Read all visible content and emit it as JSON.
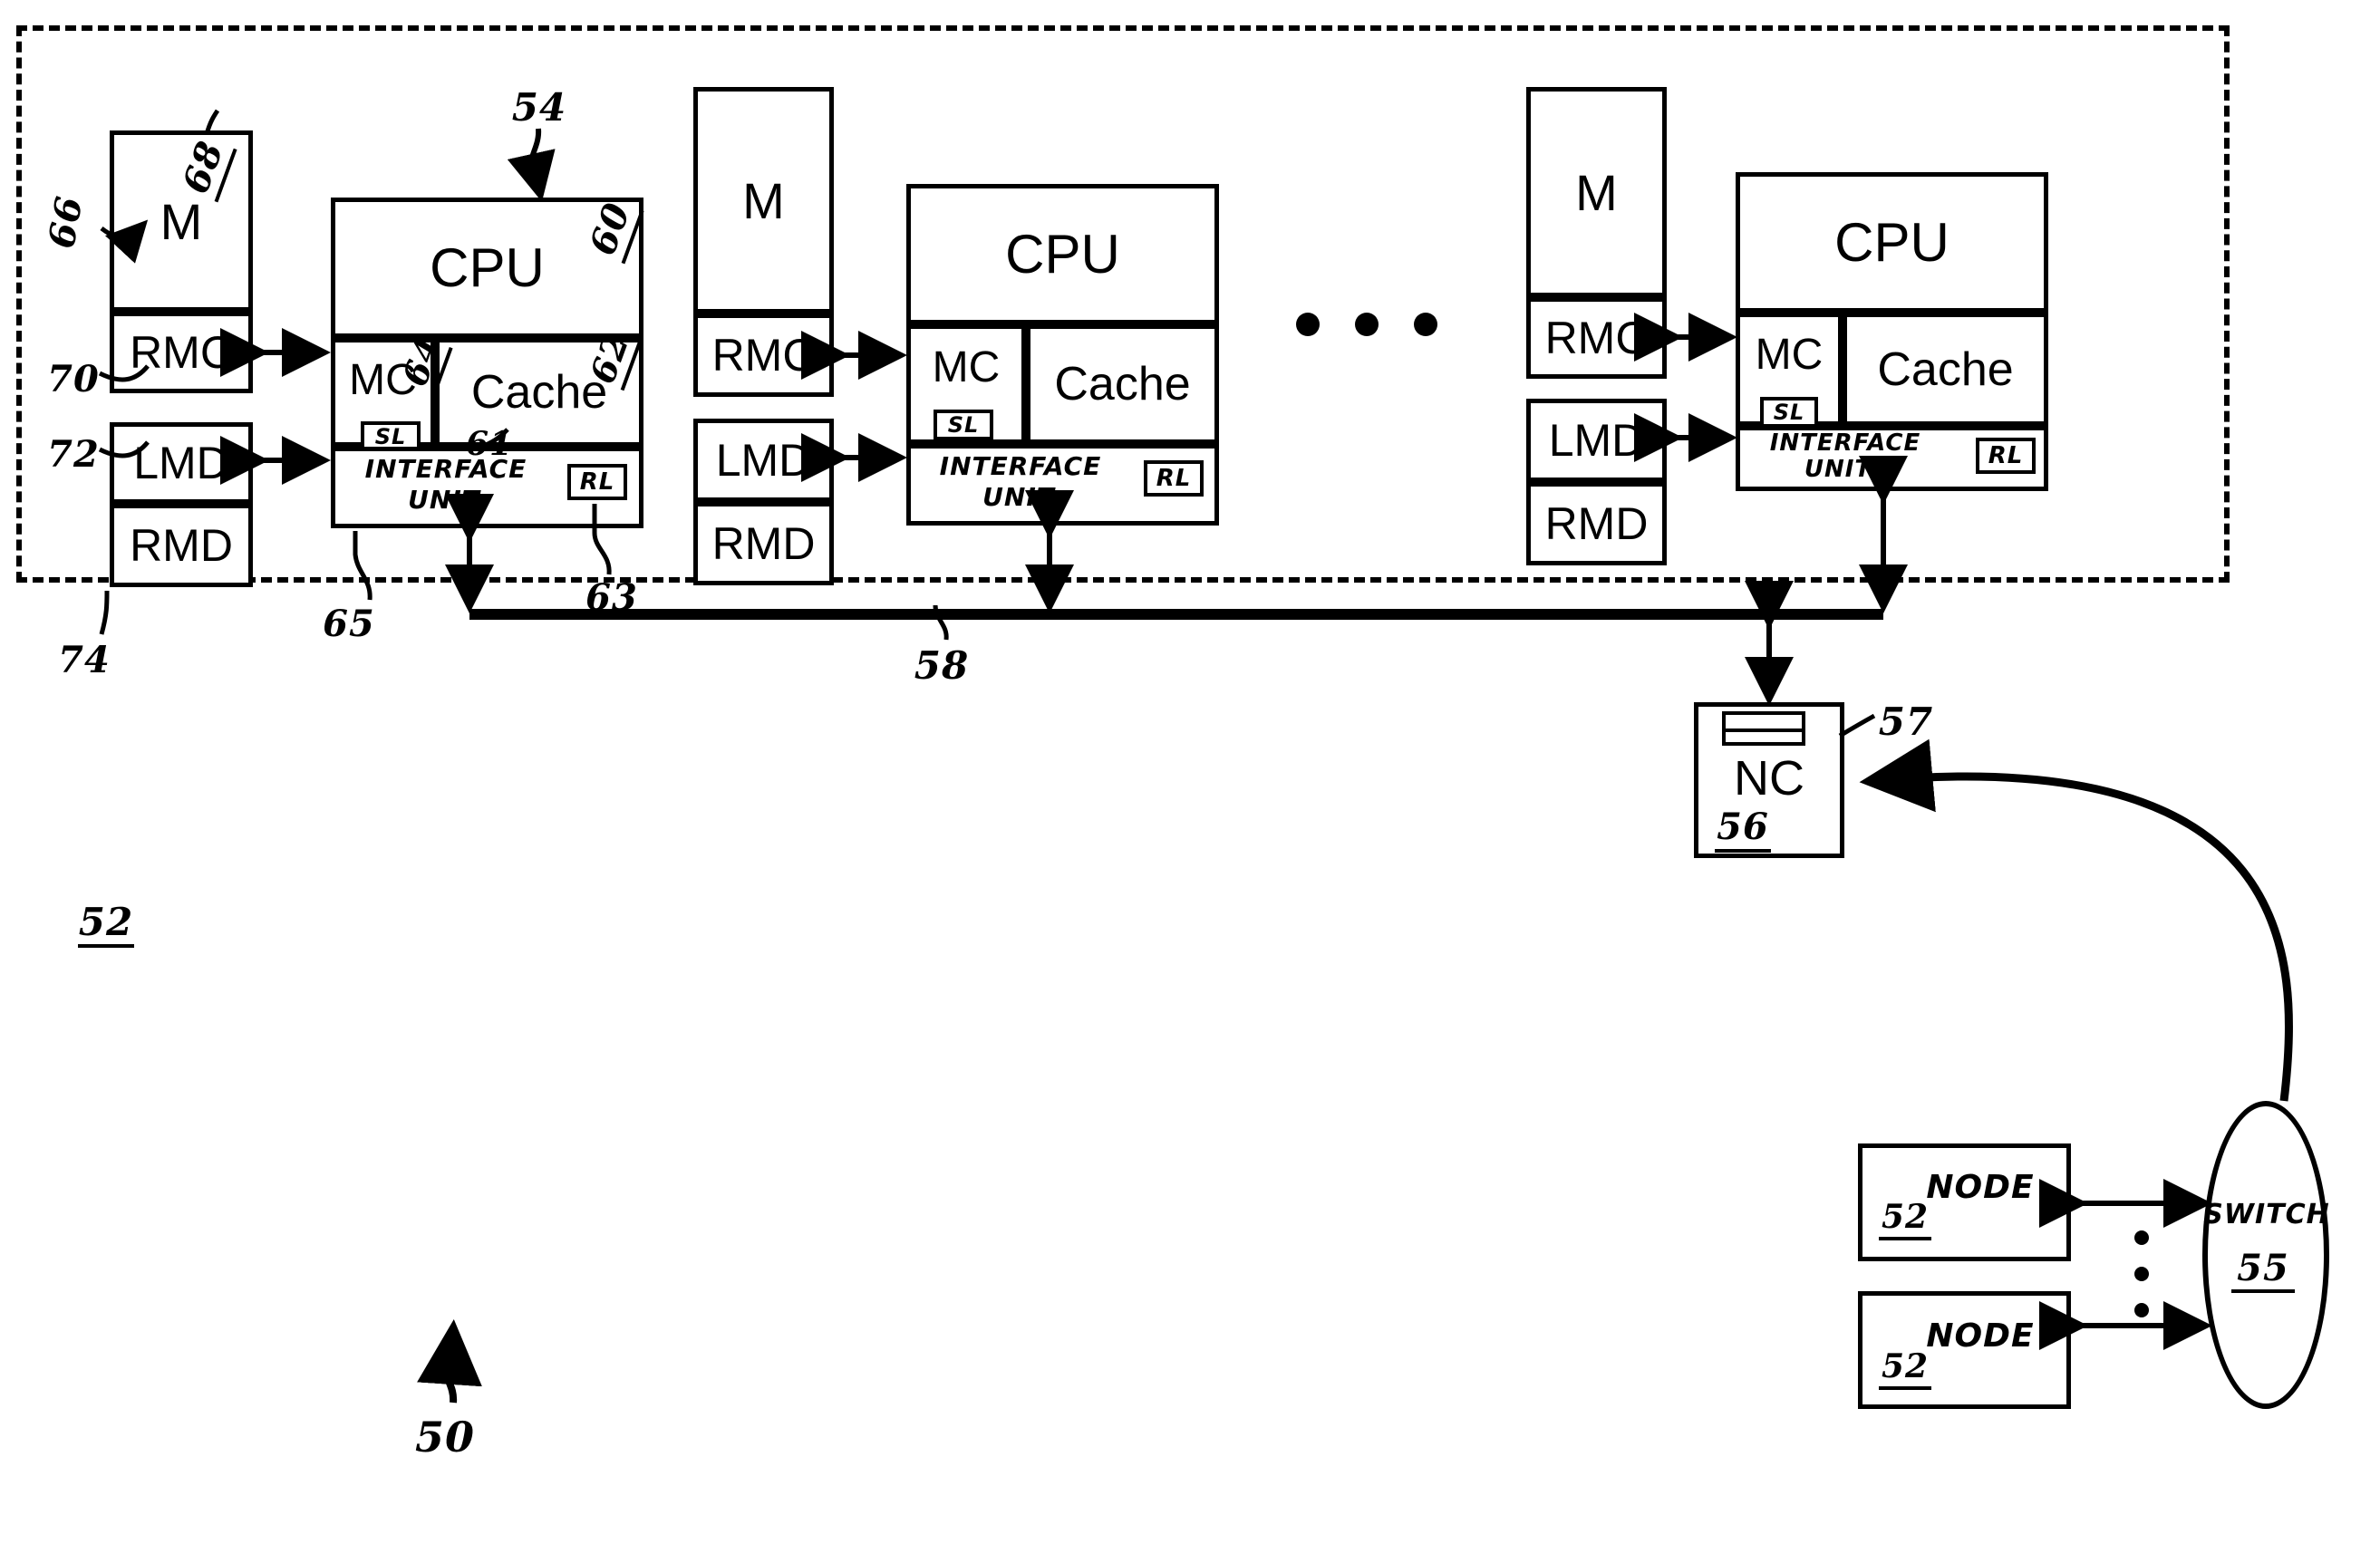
{
  "figure": {
    "title_ref": "50",
    "node_boundary_ref": "52",
    "bus_ref": "58"
  },
  "labels": {
    "memory": "M",
    "rmc": "RMC",
    "lmd": "LMD",
    "rmd": "RMD",
    "cpu": "CPU",
    "mc": "MC",
    "cache": "Cache",
    "interface_unit_line1": "INTERFACE",
    "interface_unit_line2": "UNIT",
    "sl": "SL",
    "rl": "RL",
    "nc": "NC",
    "node": "NODE",
    "switch": "SWITCH"
  },
  "refs": {
    "r50": "50",
    "r52": "52",
    "r54": "54",
    "r55": "55",
    "r56": "56",
    "r57": "57",
    "r58": "58",
    "r60": "60",
    "r61": "61",
    "r62": "62",
    "r63": "63",
    "r64": "64",
    "r65": "65",
    "r66": "66",
    "r68": "68",
    "r70": "70",
    "r72": "72",
    "r74": "74",
    "node_a": "52",
    "node_b": "52"
  },
  "processing_units": [
    {
      "id": "unit-1",
      "memory": "M",
      "memory_ref": "68",
      "rmc": "RMC",
      "rmc_ref": "70",
      "lmd": "LMD",
      "lmd_ref": "72",
      "rmd": "RMD",
      "rmd_ref": "74",
      "cpu": "CPU",
      "cpu_ref": "60",
      "mc": "MC",
      "mc_ref": "64",
      "cache": "Cache",
      "cache_ref": "62",
      "sl": "SL",
      "sl_ref": "61",
      "rl": "RL",
      "rl_ref": "63",
      "interface_unit": "INTERFACE UNIT",
      "interface_unit_ref": "65",
      "unit_ref": "54",
      "memory_system_ref": "66"
    },
    {
      "id": "unit-2",
      "memory": "M",
      "rmc": "RMC",
      "lmd": "LMD",
      "rmd": "RMD",
      "cpu": "CPU",
      "mc": "MC",
      "cache": "Cache",
      "sl": "SL",
      "rl": "RL",
      "interface_unit": "INTERFACE UNIT"
    },
    {
      "id": "unit-n",
      "memory": "M",
      "rmc": "RMC",
      "lmd": "LMD",
      "rmd": "RMD",
      "cpu": "CPU",
      "mc": "MC",
      "cache": "Cache",
      "sl": "SL",
      "rl": "RL",
      "interface_unit": "INTERFACE UNIT"
    }
  ],
  "network": {
    "controller": "NC",
    "controller_ref": "56",
    "controller_queue_ref": "57",
    "switch": "SWITCH",
    "switch_ref": "55",
    "nodes": [
      {
        "label": "NODE",
        "ref": "52"
      },
      {
        "label": "NODE",
        "ref": "52"
      }
    ]
  }
}
